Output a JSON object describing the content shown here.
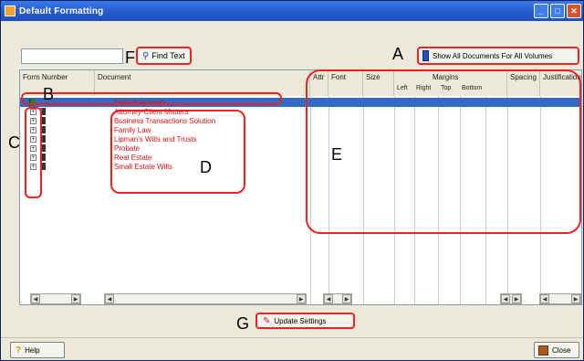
{
  "window": {
    "title": "Default Formatting",
    "controls": [
      "_",
      "□",
      "✕"
    ]
  },
  "search": {
    "value": "",
    "find_label": "Find Text"
  },
  "show_all_label": "Show All Documents For All Volumes",
  "columns": {
    "form_number": "Form Number",
    "document": "Document",
    "attr": "Attr",
    "font": "Font",
    "size": "Size",
    "margins": "Margins",
    "left": "Left",
    "right": "Right",
    "top": "Top",
    "bottom": "Bottom",
    "spacing": "Spacing",
    "justification": "Justification"
  },
  "rows": [
    {
      "document": "Default Formats"
    },
    {
      "document": "Attorney-Client Matters"
    },
    {
      "document": "Business Transactions Solution"
    },
    {
      "document": "Family Law"
    },
    {
      "document": "Lipman's Wills and Trusts"
    },
    {
      "document": "Probate"
    },
    {
      "document": "Real Estate"
    },
    {
      "document": "Small Estate Wills"
    }
  ],
  "update_label": "Update Settings",
  "help_label": "Help",
  "close_label": "Close",
  "callouts": {
    "a": "A",
    "b": "B",
    "c": "C",
    "d": "D",
    "e": "E",
    "f": "F",
    "g": "G"
  },
  "icons": {
    "find": "binoculars-icon",
    "show_all": "book-icon",
    "update": "pencil-icon",
    "help": "question-icon",
    "close": "close-door-icon"
  }
}
